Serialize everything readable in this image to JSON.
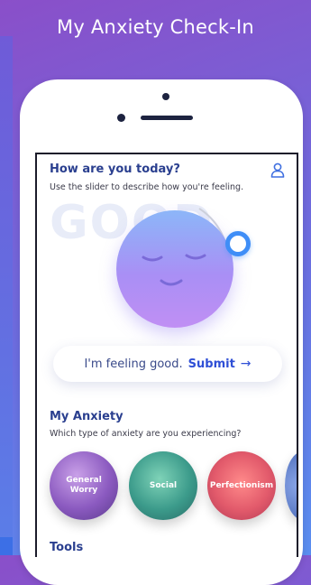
{
  "app": {
    "title": "My Anxiety Check-In"
  },
  "checkin": {
    "greeting": "How are you today?",
    "instructions": "Use the slider to describe how you're feeling.",
    "mood_word": "GOOD",
    "submit_prefix": "I'm feeling good.",
    "submit_label": "Submit",
    "submit_arrow": "→"
  },
  "anxiety": {
    "title": "My Anxiety",
    "subtitle": "Which type of anxiety are you experiencing?",
    "types": [
      {
        "label": "General Worry"
      },
      {
        "label": "Social"
      },
      {
        "label": "Perfectionism"
      }
    ]
  },
  "tools": {
    "title": "Tools"
  },
  "colors": {
    "accent": "#2f4fd6",
    "heading": "#2a3f8f",
    "knob": "#3f8ef7"
  },
  "icons": {
    "profile": "user-icon"
  }
}
